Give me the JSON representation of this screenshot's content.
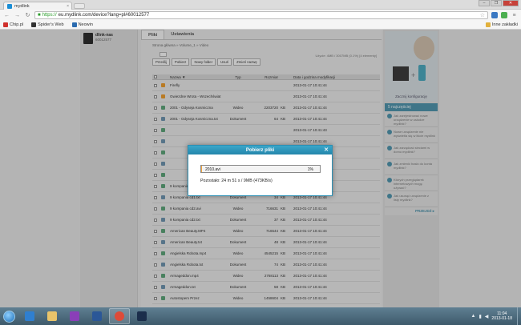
{
  "browser": {
    "tab_title": "mydlink",
    "tab_close": "×",
    "url_https": "https://",
    "url_rest": "eu.mydlink.com/device?lang=pl#60012577",
    "window_controls": [
      "–",
      "❐",
      "✕"
    ],
    "bookmarks": [
      {
        "label": "Chip.pl",
        "color": "#d0312d"
      },
      {
        "label": "Spider's Web",
        "color": "#333333"
      },
      {
        "label": "Neowin",
        "color": "#2a6bb0"
      }
    ],
    "other_bookmarks": "Inne zakładki"
  },
  "device": {
    "name": "dlink-nas",
    "id": "60012577"
  },
  "main": {
    "tabs": [
      "Pliki",
      "Ustawienia"
    ],
    "breadcrumb": "Strona główna » Volume_1 » Video",
    "disk_info": "Użycie: 4MB / 3007MB (0.1%) [4 elementy]",
    "actions": [
      "Prześlij",
      "Pobierz",
      "Nowy folder",
      "Usuń",
      "Zmień nazwę"
    ],
    "columns": [
      "Nazwa ▼",
      "Typ",
      "Rozmiar",
      "",
      "Data i godzina modyfikacji"
    ],
    "rows": [
      {
        "name": "Firefly",
        "type": "",
        "size": "",
        "unit": "",
        "date": "2013-01-17 10:41:44",
        "icon": "#e2962c"
      },
      {
        "name": "Gwiezdne Wrota - Wszechświat",
        "type": "",
        "size": "",
        "unit": "",
        "date": "2013-01-17 10:41:44",
        "icon": "#e2962c"
      },
      {
        "name": "2001 - Odyseja Kosmiczna",
        "type": "Wideo",
        "size": "2203720",
        "unit": "KB",
        "date": "2013-01-17 10:41:44",
        "icon": "#5a9e74"
      },
      {
        "name": "2001 - Odyseja Kosmiczna.txt",
        "type": "Dokument",
        "size": "64",
        "unit": "KB",
        "date": "2013-01-17 10:41:44",
        "icon": "#6a8ea8"
      },
      {
        "name": "",
        "type": "",
        "size": "",
        "unit": "",
        "date": "2013-01-17 10:41:43",
        "icon": "#5a9e74"
      },
      {
        "name": "",
        "type": "",
        "size": "",
        "unit": "",
        "date": "2013-01-17 10:41:44",
        "icon": "#6a8ea8"
      },
      {
        "name": "",
        "type": "",
        "size": "",
        "unit": "",
        "date": "2013-01-17 10:41:44",
        "icon": "#5a9e74"
      },
      {
        "name": "",
        "type": "",
        "size": "",
        "unit": "",
        "date": "2013-01-17 10:41:44",
        "icon": "#6a8ea8"
      },
      {
        "name": "",
        "type": "",
        "size": "",
        "unit": "",
        "date": "2013-01-17 10:41:44",
        "icon": "#5a9e74"
      },
      {
        "name": "9 kompania cd1.avi",
        "type": "Wideo",
        "size": "716008",
        "unit": "KB",
        "date": "2013-01-17 10:41:44",
        "icon": "#5a9e74"
      },
      {
        "name": "9 kompania cd1.txt",
        "type": "Dokument",
        "size": "34",
        "unit": "KB",
        "date": "2013-01-17 10:41:44",
        "icon": "#6a8ea8"
      },
      {
        "name": "9 kompania cd2.avi",
        "type": "Wideo",
        "size": "716631",
        "unit": "KB",
        "date": "2013-01-17 10:41:44",
        "icon": "#5a9e74"
      },
      {
        "name": "9 kompania cd2.txt",
        "type": "Dokument",
        "size": "37",
        "unit": "KB",
        "date": "2013-01-17 10:41:44",
        "icon": "#6a8ea8"
      },
      {
        "name": "American Beauty.MP4",
        "type": "Wideo",
        "size": "716544",
        "unit": "KB",
        "date": "2013-01-17 10:41:44",
        "icon": "#5a9e74"
      },
      {
        "name": "American Beauty.txt",
        "type": "Dokument",
        "size": "48",
        "unit": "KB",
        "date": "2013-01-17 10:41:44",
        "icon": "#6a8ea8"
      },
      {
        "name": "Angielska Robota.mp4",
        "type": "Wideo",
        "size": "4545215",
        "unit": "KB",
        "date": "2013-01-17 10:41:44",
        "icon": "#5a9e74"
      },
      {
        "name": "Angielska Robota.txt",
        "type": "Dokument",
        "size": "74",
        "unit": "KB",
        "date": "2013-01-17 10:41:44",
        "icon": "#6a8ea8"
      },
      {
        "name": "Armageddon.mp4",
        "type": "Wideo",
        "size": "2768113",
        "unit": "KB",
        "date": "2013-01-17 10:41:44",
        "icon": "#5a9e74"
      },
      {
        "name": "Armageddon.txt",
        "type": "Dokument",
        "size": "58",
        "unit": "KB",
        "date": "2013-01-17 10:41:44",
        "icon": "#6a8ea8"
      },
      {
        "name": "Autostopem Przez",
        "type": "Wideo",
        "size": "1458604",
        "unit": "KB",
        "date": "2013-01-17 10:41:44",
        "icon": "#5a9e74"
      }
    ]
  },
  "sidebar": {
    "promo_caption": "Zacznij konfigurację",
    "popular_title": "5 najczęściej",
    "more": "PRZEJDŹ ▸",
    "questions": [
      "Jak zarejestrować nowe urządzenie w usłudze mydlink?",
      "Nowe urządzenie nie wyświetla się w liście mydlink",
      "Jak zarządzać sieciami w domu mydlink?",
      "Jak zmienić hasło do konta mydlink?",
      "Których przeglądarek internetowych mogę używać?",
      "Jak usunąć urządzenie z listy mydlink?"
    ]
  },
  "modal": {
    "title": "Pobierz pliki",
    "close": "✕",
    "file_name": "2010.avi",
    "percent_text": "1%",
    "progress_fraction": 0.01,
    "remaining": "Pozostało: 24 m 51 s / 9MB (473KB/s)"
  },
  "taskbar": {
    "apps": [
      {
        "name": "internet-explorer",
        "color": "#2f7fd0"
      },
      {
        "name": "file-explorer",
        "color": "#e9c46a"
      },
      {
        "name": "media-player",
        "color": "#8a3fb8"
      },
      {
        "name": "word",
        "color": "#2b5797"
      },
      {
        "name": "chrome",
        "color": "#dd4b39"
      },
      {
        "name": "photoshop",
        "color": "#1b2e4b"
      }
    ],
    "time": "11:04",
    "date": "2013-01-18"
  },
  "colors": {
    "accent": "#2486ab",
    "progress": "#f1a33a"
  }
}
